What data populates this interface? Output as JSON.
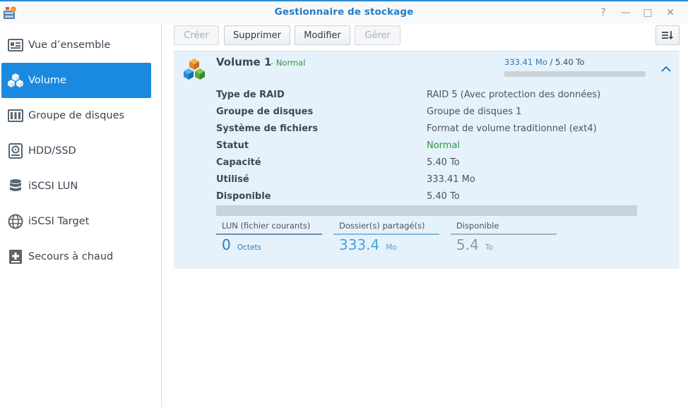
{
  "window": {
    "title": "Gestionnaire de stockage",
    "controls": [
      "?",
      "—",
      "□",
      "✕"
    ]
  },
  "sidebar": {
    "items": [
      {
        "label": "Vue d’ensemble",
        "icon": "overview-icon",
        "active": false
      },
      {
        "label": "Volume",
        "icon": "volume-cubes-icon",
        "active": true
      },
      {
        "label": "Groupe de disques",
        "icon": "disk-group-icon",
        "active": false
      },
      {
        "label": "HDD/SSD",
        "icon": "hdd-icon",
        "active": false
      },
      {
        "label": "iSCSI LUN",
        "icon": "database-icon",
        "active": false
      },
      {
        "label": "iSCSI Target",
        "icon": "globe-icon",
        "active": false
      },
      {
        "label": "Secours à chaud",
        "icon": "hot-spare-icon",
        "active": false
      }
    ]
  },
  "toolbar": {
    "create_label": "Créer",
    "delete_label": "Supprimer",
    "modify_label": "Modifier",
    "manage_label": "Gérer"
  },
  "volume": {
    "name": "Volume 1",
    "separator": "-",
    "status": "Normal",
    "used": "333.41 Mo",
    "slash": "/",
    "total": "5.40 To",
    "used_fraction": 0.0001,
    "details": [
      {
        "key": "Type de RAID",
        "value": "RAID 5 (Avec protection des données)",
        "color": "default"
      },
      {
        "key": "Groupe de disques",
        "value": "Groupe de disques 1",
        "color": "default"
      },
      {
        "key": "Système de fichiers",
        "value": "Format de volume traditionnel (ext4)",
        "color": "default"
      },
      {
        "key": "Statut",
        "value": "Normal",
        "color": "green"
      },
      {
        "key": "Capacité",
        "value": "5.40 To",
        "color": "default"
      },
      {
        "key": "Utilisé",
        "value": "333.41 Mo",
        "color": "default"
      },
      {
        "key": "Disponible",
        "value": "5.40 To",
        "color": "default"
      }
    ],
    "stats": [
      {
        "label": "LUN (fichier courants)",
        "value": "0",
        "unit": "Octets",
        "color": "#2a7bbf",
        "line": "#6d8fb0"
      },
      {
        "label": "Dossier(s) partagé(s)",
        "value": "333.4",
        "unit": "Mo",
        "color": "#4aa3d8",
        "line": "#7fb9e0"
      },
      {
        "label": "Disponible",
        "value": "5.4",
        "unit": "To",
        "color": "#8d979f",
        "line": "#a9b2ba"
      }
    ]
  }
}
